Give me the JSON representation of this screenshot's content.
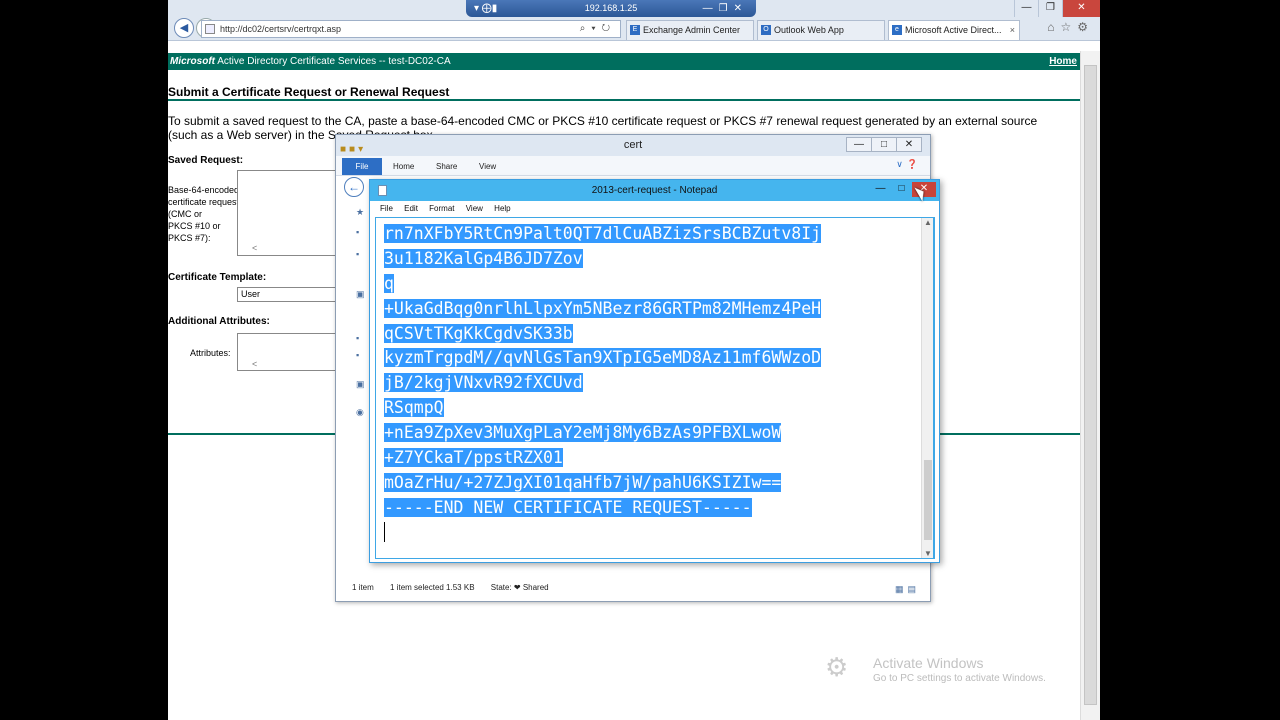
{
  "rdp": {
    "host": "192.168.1.25"
  },
  "browser": {
    "url": "http://dc02/certsrv/certrqxt.asp",
    "tabs": [
      {
        "label": "Exchange Admin Center"
      },
      {
        "label": "Outlook Web App"
      },
      {
        "label": "Microsoft Active Direct..."
      }
    ]
  },
  "page": {
    "banner_brand": "Microsoft",
    "banner_title": " Active Directory Certificate Services  --  test-DC02-CA",
    "home_link": "Home",
    "title": "Submit a Certificate Request or Renewal Request",
    "intro": "To submit a saved request to the CA, paste a base-64-encoded CMC or PKCS #10 certificate request or PKCS #7 renewal request generated by an external source (such as a Web server) in the Saved Request box.",
    "saved_request_label": "Saved Request:",
    "request_type_lines": [
      "Base-64-encoded",
      "certificate request",
      "(CMC or",
      "PKCS #10 or",
      "PKCS #7):"
    ],
    "template_label": "Certificate Template:",
    "template_value": "User",
    "additional_attributes_label": "Additional Attributes:",
    "attributes_label": "Attributes:"
  },
  "explorer": {
    "title": "cert",
    "ribbon": {
      "file": "File",
      "home": "Home",
      "share": "Share",
      "view": "View"
    },
    "status": {
      "items": "1 item",
      "selected": "1 item selected  1.53 KB",
      "state": "State: ❤ Shared"
    }
  },
  "notepad": {
    "title": "2013-cert-request - Notepad",
    "menu": [
      "File",
      "Edit",
      "Format",
      "View",
      "Help"
    ],
    "lines": [
      "rn7nXFbY5RtCn9Palt0QT7dlCuABZizSrsBCBZutv8Ij",
      "3u1182KalGp4B6JD7Zov",
      "q",
      "+UkaGdBqg0nrlhLlpxYm5NBezr86GRTPm82MHemz4PeH",
      "qCSVtTKgKkCgdvSK33b",
      "kyzmTrgpdM//qvNlGsTan9XTpIG5eMD8Az11mf6WWzoD",
      "jB/2kgjVNxvR92fXCUvd",
      "RSqmpQ",
      "+nEa9ZpXev3MuXgPLaY2eMj8My6BzAs9PFBXLwoW",
      "+Z7YCkaT/ppstRZX01",
      "mOaZrHu/+27ZJgXI01qaHfb7jW/pahU6KSIZIw==",
      "-----END NEW CERTIFICATE REQUEST-----"
    ]
  },
  "watermark": {
    "title": "Activate Windows",
    "subtitle": "Go to PC settings to activate Windows."
  }
}
